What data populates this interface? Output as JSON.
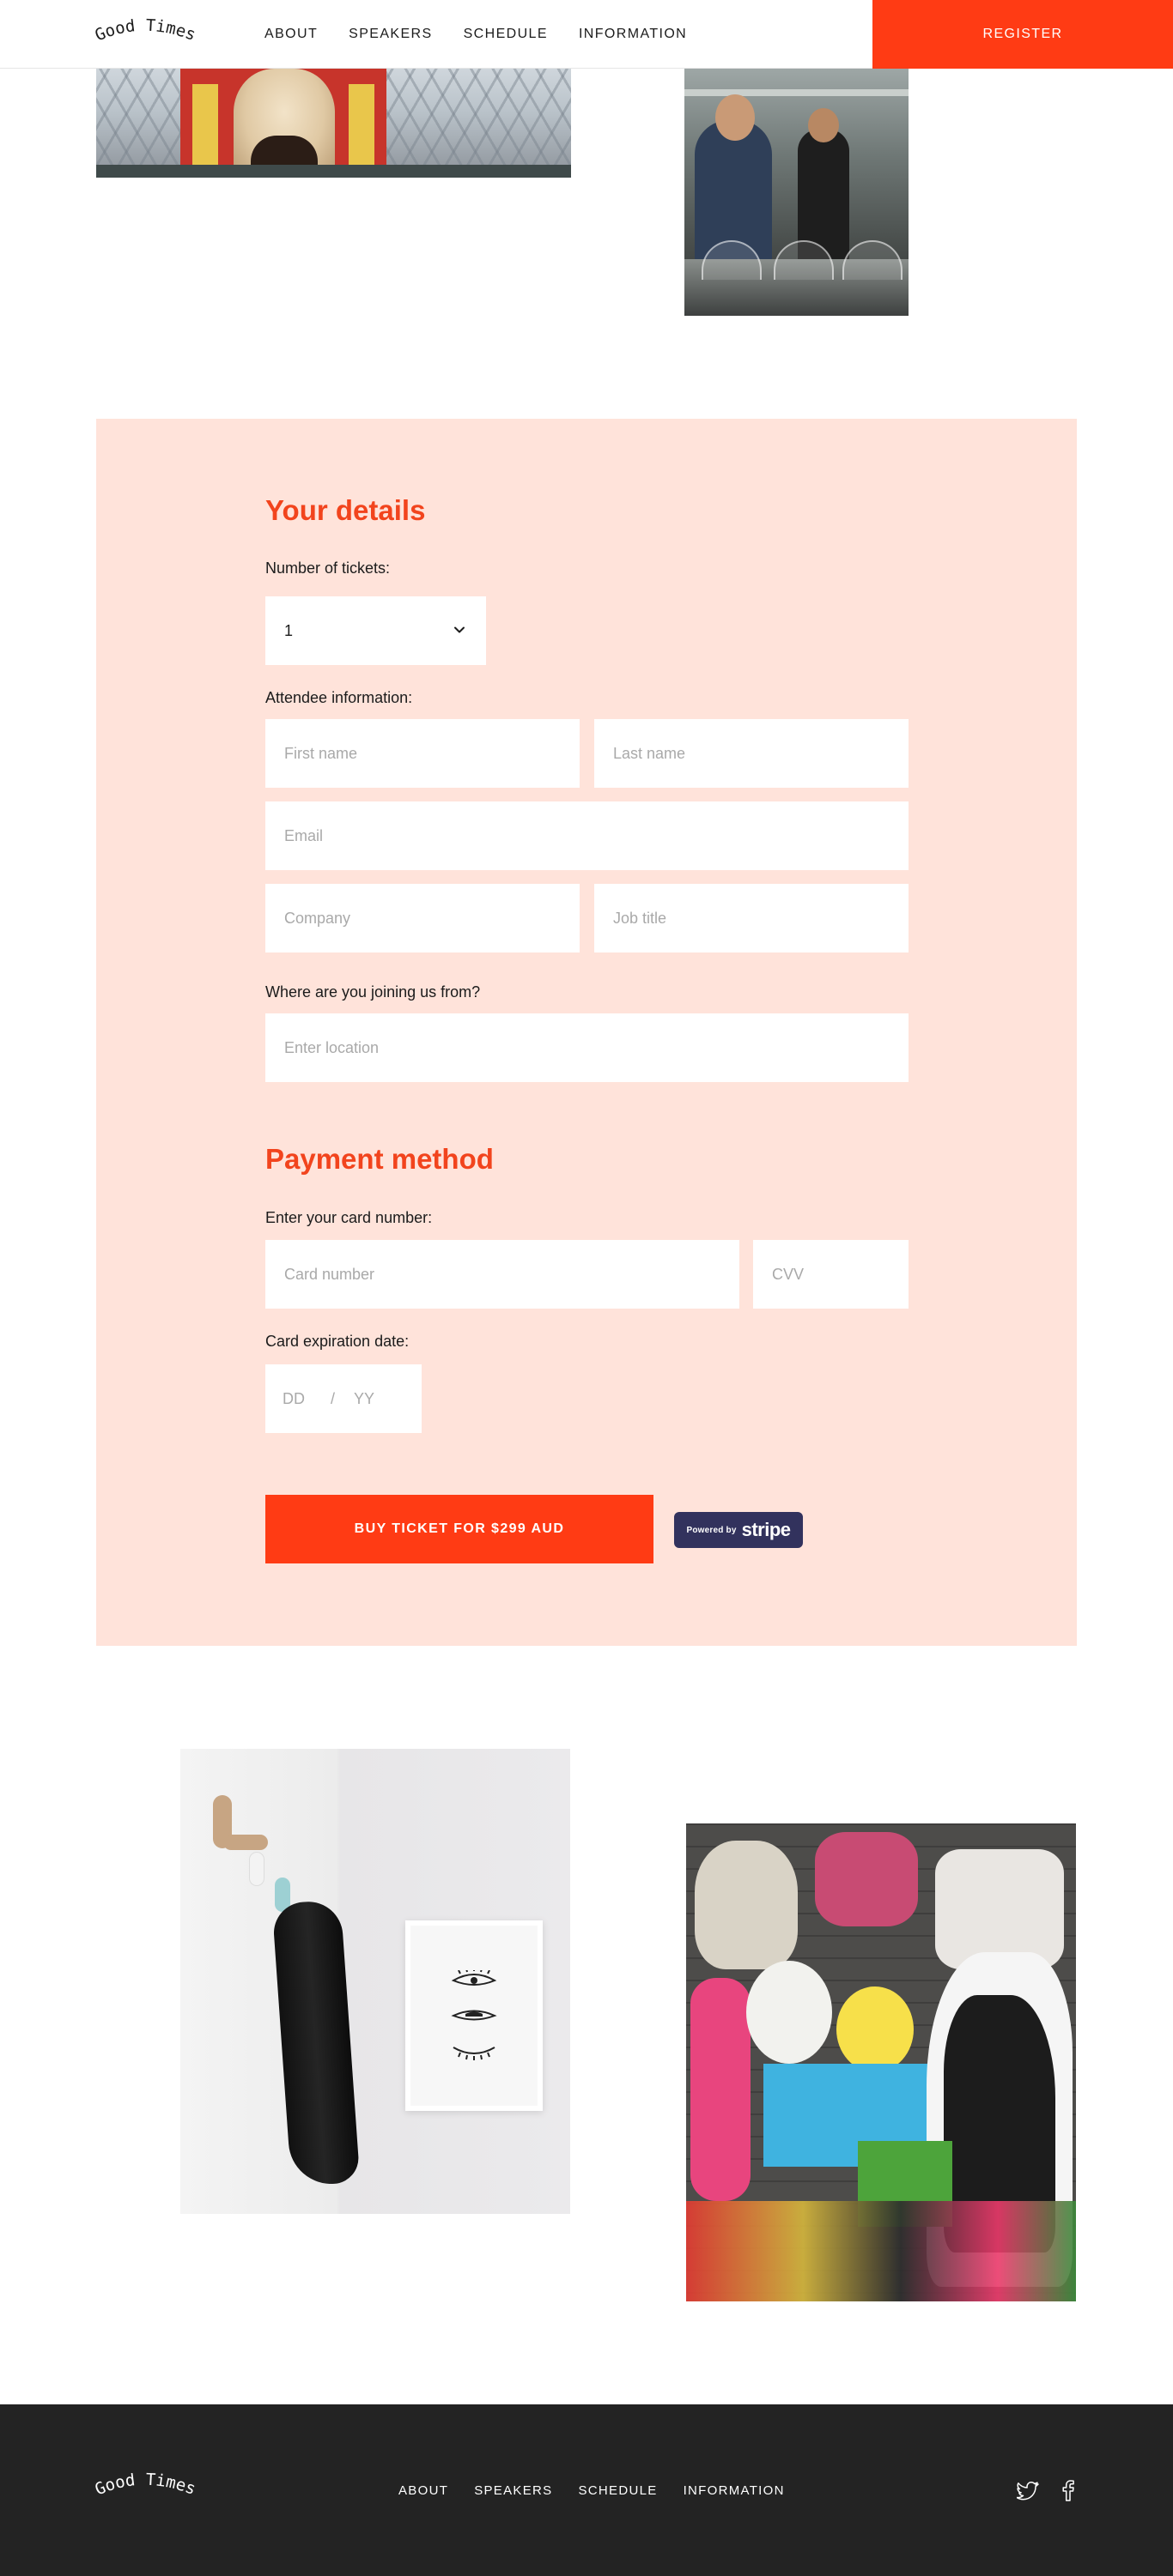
{
  "brand": {
    "name": "Good Times"
  },
  "nav": {
    "items": [
      {
        "label": "ABOUT"
      },
      {
        "label": "SPEAKERS"
      },
      {
        "label": "SCHEDULE"
      },
      {
        "label": "INFORMATION"
      }
    ],
    "register_label": "REGISTER"
  },
  "details": {
    "title": "Your details",
    "tickets_label": "Number of tickets:",
    "tickets_value": "1",
    "attendee_label": "Attendee information:",
    "first_name_placeholder": "First name",
    "last_name_placeholder": "Last name",
    "email_placeholder": "Email",
    "company_placeholder": "Company",
    "job_title_placeholder": "Job title",
    "location_label": "Where are you joining us from?",
    "location_placeholder": "Enter location"
  },
  "payment": {
    "title": "Payment method",
    "card_label": "Enter your card number:",
    "card_placeholder": "Card number",
    "cvv_placeholder": "CVV",
    "expiry_label": "Card expiration date:",
    "expiry_day_placeholder": "DD",
    "expiry_separator": "/",
    "expiry_year_placeholder": "YY",
    "buy_label": "BUY TICKET FOR $299 AUD",
    "stripe_prefix": "Powered by",
    "stripe_word": "stripe"
  },
  "footer": {
    "items": [
      {
        "label": "ABOUT"
      },
      {
        "label": "SPEAKERS"
      },
      {
        "label": "SCHEDULE"
      },
      {
        "label": "INFORMATION"
      }
    ],
    "social": [
      {
        "icon": "twitter-icon"
      },
      {
        "icon": "facebook-icon"
      }
    ]
  },
  "colors": {
    "accent": "#ff3b14",
    "title_orange": "#f2441d",
    "form_background": "#ffe3da",
    "footer_background": "#232323",
    "stripe_badge": "#32325d"
  }
}
